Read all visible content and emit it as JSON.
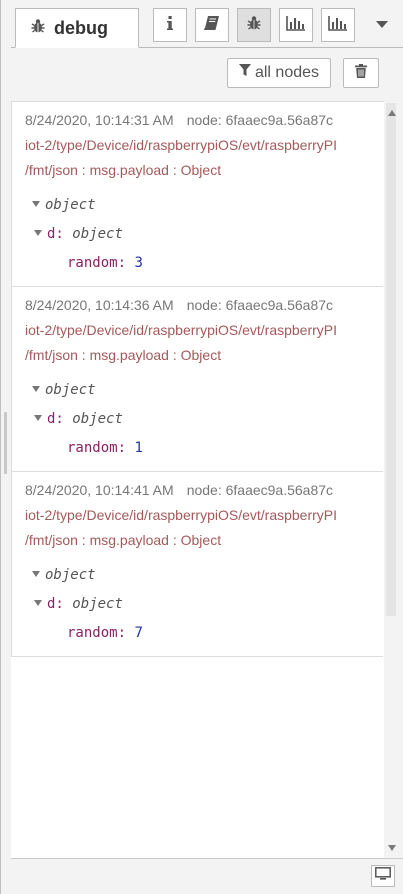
{
  "tabs": {
    "active_label": "debug",
    "active_icon": "bug-icon",
    "buttons": [
      {
        "name": "info-tab-button",
        "icon": "info-icon"
      },
      {
        "name": "help-tab-button",
        "icon": "book-icon"
      },
      {
        "name": "debug-tab-button",
        "icon": "bug-icon"
      },
      {
        "name": "dashboard-tab-button",
        "icon": "bar-chart-icon"
      },
      {
        "name": "dashboard-layout-tab-button",
        "icon": "bar-chart-icon"
      }
    ],
    "dropdown_icon": "caret-down-icon"
  },
  "toolbar": {
    "filter_label": "all nodes",
    "filter_icon": "filter-icon",
    "clear_icon": "trash-icon"
  },
  "messages": [
    {
      "timestamp": "8/24/2020, 10:14:31 AM",
      "node": "node: 6faaec9a.56a87c",
      "topic_line1": "iot-2/type/Device/id/raspberrypiOS/evt/raspberryPI",
      "topic_line2": "/fmt/json : msg.payload : Object",
      "root_type": "object",
      "child_key": "d:",
      "child_type": "object",
      "leaf_key": "random:",
      "leaf_value": "3"
    },
    {
      "timestamp": "8/24/2020, 10:14:36 AM",
      "node": "node: 6faaec9a.56a87c",
      "topic_line1": "iot-2/type/Device/id/raspberrypiOS/evt/raspberryPI",
      "topic_line2": "/fmt/json : msg.payload : Object",
      "root_type": "object",
      "child_key": "d:",
      "child_type": "object",
      "leaf_key": "random:",
      "leaf_value": "1"
    },
    {
      "timestamp": "8/24/2020, 10:14:41 AM",
      "node": "node: 6faaec9a.56a87c",
      "topic_line1": "iot-2/type/Device/id/raspberrypiOS/evt/raspberryPI",
      "topic_line2": "/fmt/json : msg.payload : Object",
      "root_type": "object",
      "child_key": "d:",
      "child_type": "object",
      "leaf_key": "random:",
      "leaf_value": "7"
    }
  ],
  "footer": {
    "window_icon": "monitor-icon"
  },
  "colors": {
    "topic": "#a35a5a",
    "meta": "#777777",
    "key": "#882266",
    "number": "#2032a8"
  }
}
